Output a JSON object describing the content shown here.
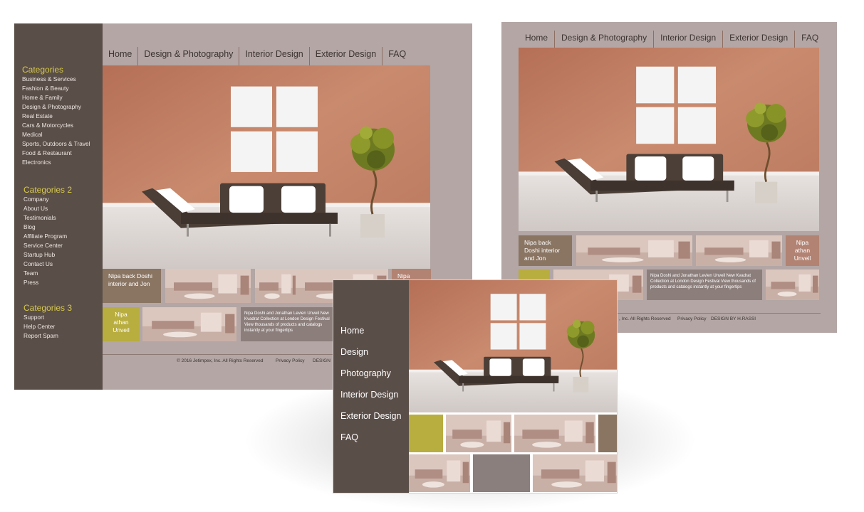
{
  "mockup1": {
    "nav": [
      "Home",
      "Design & Photography",
      "Interior Design",
      "Exterior Design",
      "FAQ"
    ],
    "sidebar": {
      "groups": [
        {
          "title": "Categories",
          "items": [
            "Business & Services",
            "Fashion & Beauty",
            "Home & Family",
            "Design & Photography",
            "Real Estate",
            "Cars & Motorcycles",
            "Medical",
            "Sports, Outdoors & Travel",
            "Food & Restaurant",
            "Electronics"
          ]
        },
        {
          "title": "Categories 2",
          "items": [
            "Company",
            "About Us",
            "Testimonials",
            "Blog",
            "Affiliate Program",
            "Service Center",
            "Startup Hub",
            "Contact Us",
            "Team",
            "Press"
          ]
        },
        {
          "title": "Categories 3",
          "items": [
            "Support",
            "Help Center",
            "Report Spam"
          ]
        }
      ]
    },
    "tiles": {
      "nipa_back": "Nipa  back Doshi  interior and Jon",
      "nipa_athan": "Nipa athan Unveil",
      "nipa_edge": "Nipa",
      "description": "Nipa Doshi and Jonathan Levien Unveil New Kvadrat Collection at London Design Festival View thousands of products and catalogs instantly at your fingertips"
    },
    "footer": {
      "copyright": "© 2016 Jetimpex, Inc. All Rights Reserved",
      "privacy": "Privacy Policy",
      "design": "DESIGN"
    }
  },
  "mockup2": {
    "nav": [
      "Home",
      "Design & Photography",
      "Interior Design",
      "Exterior Design",
      "FAQ"
    ],
    "tiles": {
      "nipa_back": "Nipa  back Doshi  interior and Jon",
      "nipa_athan": "Nipa athan Unveil",
      "nipa_edge": "Nipa",
      "description": "Nipa Doshi and Jonathan Levien Unveil New Kvadrat Collection at London Design Festival View thousands of products and catalogs instantly at your fingertips"
    },
    "footer": {
      "copyright": ", Inc. All Rights Reserved",
      "privacy": "Privacy Policy",
      "design": "DESIGN BY H.RASSI"
    }
  },
  "mockup3": {
    "menu": [
      "Home",
      "Design",
      "Photography",
      "Interior Design",
      "Exterior Design",
      "FAQ"
    ]
  },
  "colors": {
    "sidebar": "#5a4e48",
    "page_background": "#b3a6a5",
    "accent_yellow": "#d6c94a",
    "wall": "#c4856a",
    "olive_tile": "#b8ad3f",
    "brown_tile": "#8a7563"
  }
}
